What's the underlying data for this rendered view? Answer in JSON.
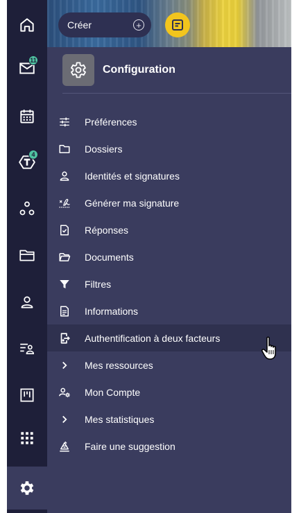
{
  "rail": {
    "items": [
      {
        "name": "home-icon"
      },
      {
        "name": "mail-icon",
        "badge": "11"
      },
      {
        "name": "calendar-icon"
      },
      {
        "name": "t-app-icon",
        "badge": "4"
      },
      {
        "name": "connections-icon"
      },
      {
        "name": "folder-icon"
      },
      {
        "name": "contact-icon"
      },
      {
        "name": "list-user-icon"
      },
      {
        "name": "board-icon"
      },
      {
        "name": "apps-grid-icon"
      },
      {
        "name": "gear-icon",
        "active": true
      }
    ]
  },
  "toolbar": {
    "create_label": "Créer",
    "plus_glyph": "+"
  },
  "panel": {
    "title": "Configuration"
  },
  "menu": {
    "items": [
      {
        "label": "Préférences",
        "icon": "sliders-icon"
      },
      {
        "label": "Dossiers",
        "icon": "folder-outline-icon"
      },
      {
        "label": "Identités et signatures",
        "icon": "person-icon"
      },
      {
        "label": "Générer ma signature",
        "icon": "signature-icon"
      },
      {
        "label": "Réponses",
        "icon": "doc-check-icon"
      },
      {
        "label": "Documents",
        "icon": "folder-open-icon"
      },
      {
        "label": "Filtres",
        "icon": "filter-icon"
      },
      {
        "label": "Informations",
        "icon": "doc-lines-icon"
      },
      {
        "label": "Authentification à deux facteurs",
        "icon": "device-exit-icon",
        "hovered": true
      },
      {
        "label": "Mes ressources",
        "icon": "chevron-right-icon"
      },
      {
        "label": "Mon Compte",
        "icon": "person-gear-icon"
      },
      {
        "label": "Mes statistiques",
        "icon": "chevron-right-icon"
      },
      {
        "label": "Faire une suggestion",
        "icon": "suggestion-icon"
      }
    ]
  },
  "colors": {
    "rail_bg": "#1e1f39",
    "panel_bg": "#3a3c5e",
    "accent_yellow": "#f2c51d",
    "badge_teal": "#4fc3a1"
  }
}
